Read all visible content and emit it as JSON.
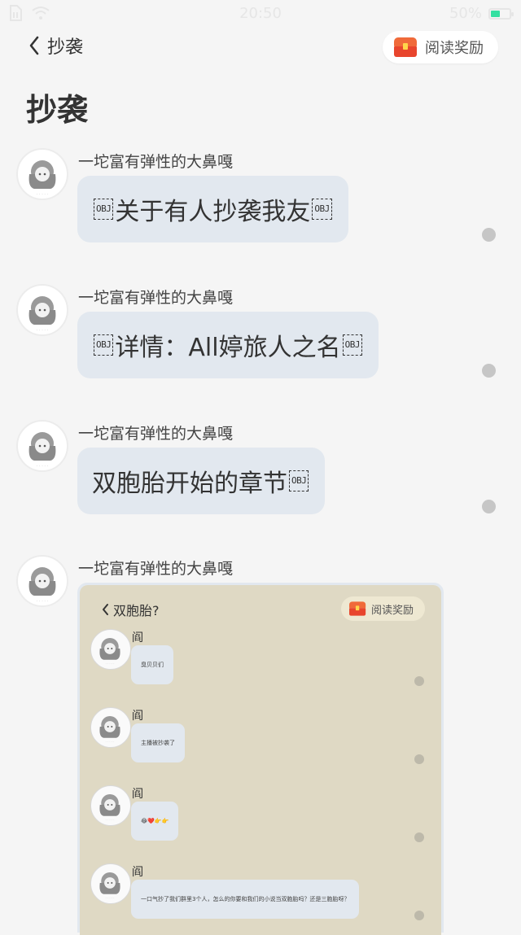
{
  "status_bar": {
    "time": "20:50",
    "battery": "50%",
    "battery_level": 0.5,
    "icons": [
      "sim-icon",
      "wifi-icon",
      "battery-icon"
    ]
  },
  "nav": {
    "back_label": "抄袭",
    "reward_label": "阅读奖励"
  },
  "page_title": "抄袭",
  "obj_placeholder": "OBJ",
  "messages": [
    {
      "sender": "一坨富有弹性的大鼻嘎",
      "parts": [
        "",
        "关于有人抄袭我友",
        ""
      ]
    },
    {
      "sender": "一坨富有弹性的大鼻嘎",
      "parts": [
        "",
        "详情：All婷旅人之名",
        ""
      ]
    },
    {
      "sender": "一坨富有弹性的大鼻嘎",
      "parts": [
        "双胞胎开始的章节",
        ""
      ]
    },
    {
      "sender": "一坨富有弹性的大鼻嘎",
      "type": "image"
    }
  ],
  "embedded_screenshot": {
    "back_label": "双胞胎?",
    "reward_label": "阅读奖励",
    "messages": [
      {
        "sender": "阎",
        "text": "臭贝贝们"
      },
      {
        "sender": "阎",
        "text": "主播被抄袭了"
      },
      {
        "sender": "阎",
        "text": "😂❤️👉👉"
      },
      {
        "sender": "阎",
        "text": "一口气抄了我们群里3个人，怎么的你要和我们的小说当双胞胎吗？还是三胞胎呀？"
      }
    ]
  },
  "colors": {
    "background": "#f5f5f5",
    "bubble": "#e2e8ef",
    "battery_fill": "#34e0a1",
    "reward_chest": "#e8452d",
    "embedded_background": "#dfd9c4"
  }
}
